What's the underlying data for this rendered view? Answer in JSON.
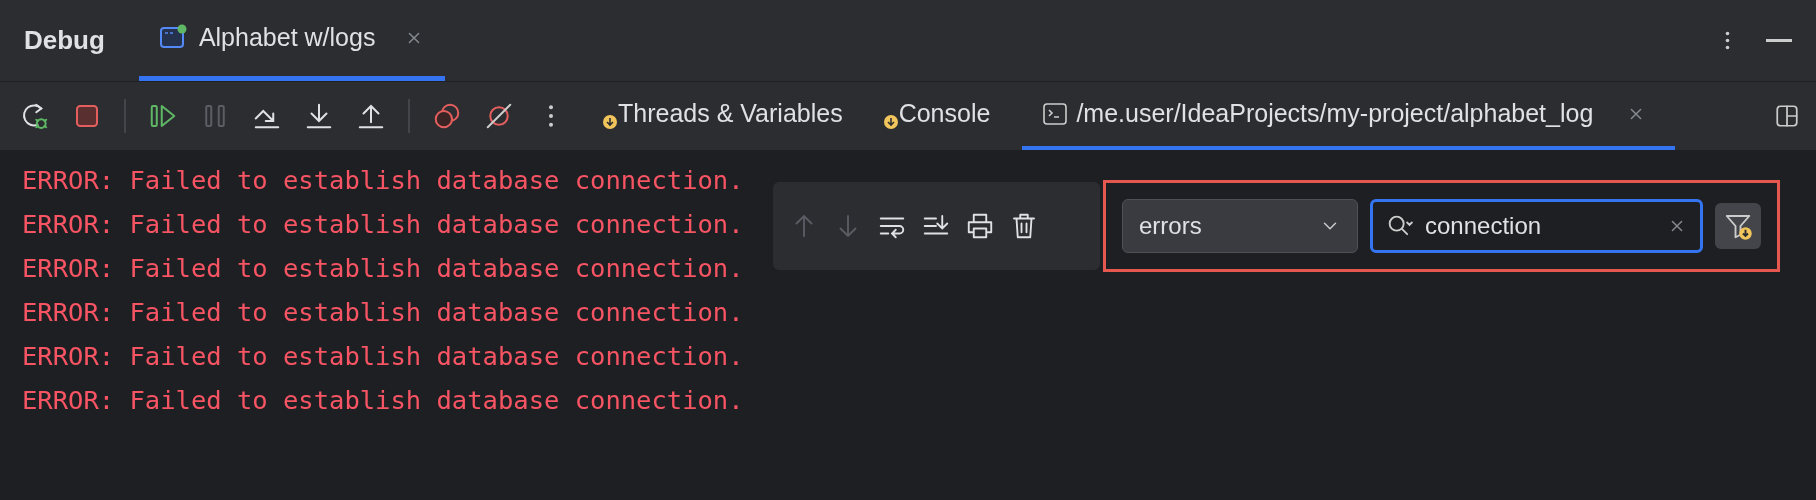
{
  "header": {
    "title": "Debug",
    "tabs": [
      {
        "label": "Alphabet w/logs",
        "selected": true,
        "running": true
      }
    ]
  },
  "toolbar": {
    "buttons": [
      {
        "kind": "rerun",
        "disabled": false
      },
      {
        "kind": "stop",
        "disabled": false
      },
      {
        "kind": "sep"
      },
      {
        "kind": "resume",
        "disabled": false
      },
      {
        "kind": "pause",
        "disabled": true
      },
      {
        "kind": "step-over",
        "disabled": false
      },
      {
        "kind": "step-into",
        "disabled": false
      },
      {
        "kind": "step-out",
        "disabled": false
      },
      {
        "kind": "sep"
      },
      {
        "kind": "breakpoints",
        "disabled": false
      },
      {
        "kind": "mute",
        "disabled": false
      },
      {
        "kind": "more",
        "disabled": false
      }
    ]
  },
  "tabs": [
    {
      "label": "Threads & Variables",
      "selected": false,
      "kind": "badge"
    },
    {
      "label": "Console",
      "selected": false,
      "kind": "badge"
    },
    {
      "label": "/me.user/IdeaProjects/my-project/alphabet_log",
      "selected": true,
      "kind": "terminal"
    }
  ],
  "console": {
    "lines": [
      "ERROR: Failed to establish database connection.",
      "ERROR: Failed to establish database connection.",
      "ERROR: Failed to establish database connection.",
      "ERROR: Failed to establish database connection.",
      "ERROR: Failed to establish database connection.",
      "ERROR: Failed to establish database connection."
    ]
  },
  "find_toolbar": {
    "buttons": [
      {
        "kind": "up",
        "disabled": true
      },
      {
        "kind": "down",
        "disabled": true
      },
      {
        "kind": "wrap",
        "disabled": false
      },
      {
        "kind": "scroll-end",
        "disabled": false
      },
      {
        "kind": "print",
        "disabled": false
      },
      {
        "kind": "clear",
        "disabled": false
      }
    ],
    "filter": {
      "value": "errors"
    },
    "search": {
      "value": "connection"
    }
  }
}
